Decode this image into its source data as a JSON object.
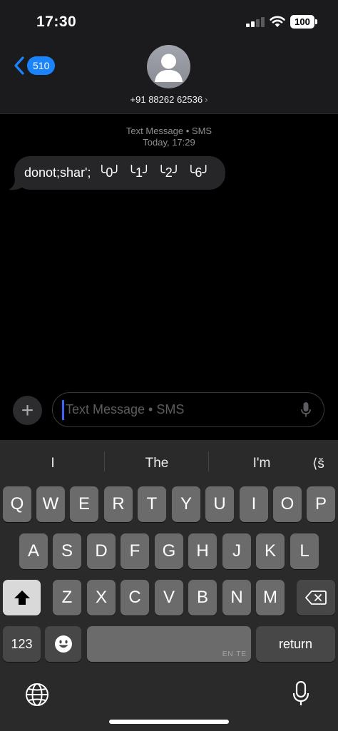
{
  "status_bar": {
    "time": "17:30",
    "battery": "100"
  },
  "header": {
    "back_count": "510",
    "contact_name": "+91 88262 62536",
    "chevron": "›"
  },
  "conversation": {
    "service_label": "Text Message • SMS",
    "timestamp": "Today, 17:29",
    "messages": [
      {
        "text": "donot;shar';  ╰0╯  ╰1╯  ╰2╯  ╰6╯",
        "direction": "incoming"
      }
    ]
  },
  "input_bar": {
    "plus_label": "+",
    "placeholder": "Text Message • SMS"
  },
  "keyboard": {
    "suggestions": [
      "I",
      "The",
      "I'm",
      "⟨š"
    ],
    "row1": [
      "Q",
      "W",
      "E",
      "R",
      "T",
      "Y",
      "U",
      "I",
      "O",
      "P"
    ],
    "row2": [
      "A",
      "S",
      "D",
      "F",
      "G",
      "H",
      "J",
      "K",
      "L"
    ],
    "row3": [
      "Z",
      "X",
      "C",
      "V",
      "B",
      "N",
      "M"
    ],
    "numbers_label": "123",
    "emoji_label": "☻",
    "return_label": "return",
    "space_lang": "EN TE"
  },
  "colors": {
    "accent": "#1a84ff",
    "caret": "#3b63ff",
    "bubble": "#262628"
  }
}
